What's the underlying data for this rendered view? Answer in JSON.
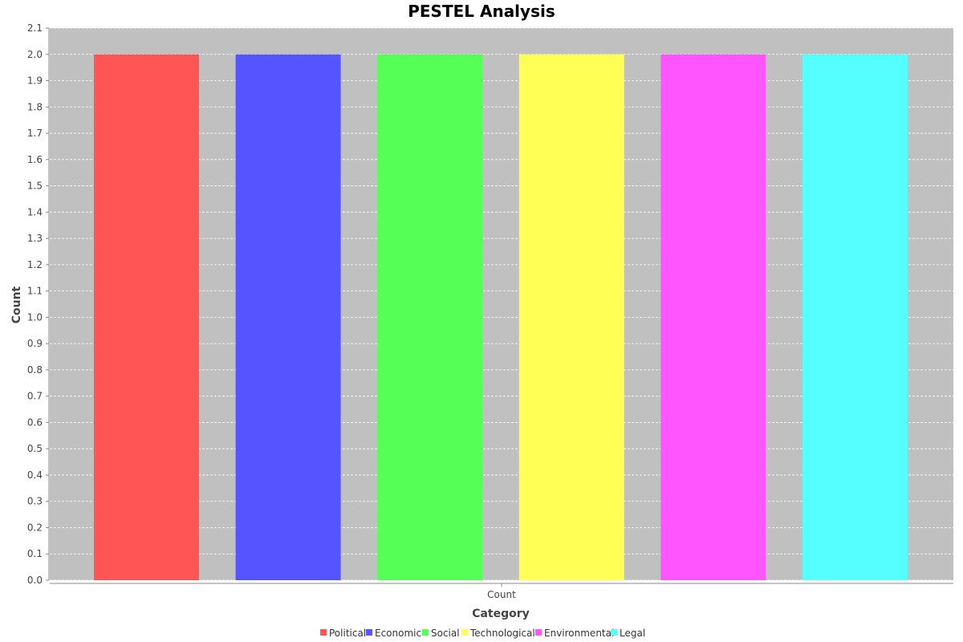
{
  "chart_data": {
    "type": "bar",
    "title": "PESTEL Analysis",
    "xlabel": "Category",
    "ylabel": "Count",
    "categories": [
      "Count"
    ],
    "series": [
      {
        "name": "Political",
        "values": [
          2.0
        ],
        "color": "#ff5555"
      },
      {
        "name": "Economic",
        "values": [
          2.0
        ],
        "color": "#5555ff"
      },
      {
        "name": "Social",
        "values": [
          2.0
        ],
        "color": "#55ff55"
      },
      {
        "name": "Technological",
        "values": [
          2.0
        ],
        "color": "#ffff55"
      },
      {
        "name": "Environmental",
        "values": [
          2.0
        ],
        "color": "#ff55ff"
      },
      {
        "name": "Legal",
        "values": [
          2.0
        ],
        "color": "#55ffff"
      }
    ],
    "ylim": [
      0,
      2.1
    ],
    "yticks": [
      "0.0",
      "0.1",
      "0.2",
      "0.3",
      "0.4",
      "0.5",
      "0.6",
      "0.7",
      "0.8",
      "0.9",
      "1.0",
      "1.1",
      "1.2",
      "1.3",
      "1.4",
      "1.5",
      "1.6",
      "1.7",
      "1.8",
      "1.9",
      "2.0",
      "2.1"
    ],
    "grid": true,
    "legend_position": "bottom",
    "plot_background": "#c0c0c0"
  }
}
